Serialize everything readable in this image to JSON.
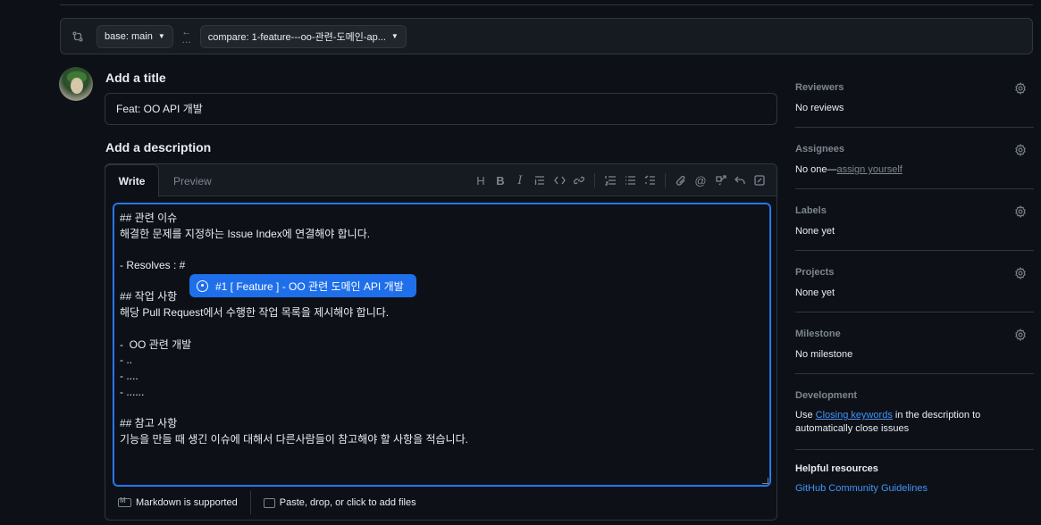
{
  "compare": {
    "base_label": "base: main",
    "compare_label": "compare: 1-feature---oo-관련-도메인-ap...",
    "arrow": "←",
    "dots": "…"
  },
  "title": {
    "heading": "Add a title",
    "value": "Feat: OO API 개발"
  },
  "description": {
    "heading": "Add a description",
    "tabs": [
      "Write",
      "Preview"
    ],
    "toolbar": {
      "heading": "H",
      "bold": "B",
      "italic": "I",
      "quote": "☰",
      "code": "<>",
      "link": "🔗",
      "ol": "☷",
      "ul": "☰",
      "tasks": "☑",
      "attach": "📎",
      "mention": "@",
      "reference": "↗",
      "undo": "↶",
      "fullscreen": "⤢"
    },
    "lines": [
      "## 관련 이슈",
      "해결한 문제를 지정하는 Issue Index에 연결해야 합니다.",
      "",
      "- Resolves : #",
      "",
      "## 작업 사항",
      "해당 Pull Request에서 수행한 작업 목록을 제시해야 합니다.",
      "",
      "-  OO 관련 개발",
      "- ..",
      "- ....",
      "- ......",
      "",
      "## 참고 사항",
      "기능을 만들 때 생긴 이슈에 대해서 다른사람들이 참고해야 할 사항을 적습니다."
    ],
    "suggestion": "#1 [ Feature ] - OO 관련 도메인 API 개발",
    "footer": {
      "markdown": "Markdown is supported",
      "files": "Paste, drop, or click to add files"
    }
  },
  "sidebar": {
    "reviewers": {
      "label": "Reviewers",
      "value": "No reviews"
    },
    "assignees": {
      "label": "Assignees",
      "value": "No one—",
      "link": "assign yourself"
    },
    "labels": {
      "label": "Labels",
      "value": "None yet"
    },
    "projects": {
      "label": "Projects",
      "value": "None yet"
    },
    "milestone": {
      "label": "Milestone",
      "value": "No milestone"
    },
    "development": {
      "label": "Development",
      "pre": "Use ",
      "link": "Closing keywords",
      "post": " in the description to",
      "line2": "automatically close issues"
    },
    "helpful": {
      "label": "Helpful resources",
      "link": "GitHub Community Guidelines"
    }
  },
  "colors": {
    "background": "#0d1117",
    "accent": "#1f6feb",
    "link": "#4493f8",
    "border": "#30363d"
  }
}
